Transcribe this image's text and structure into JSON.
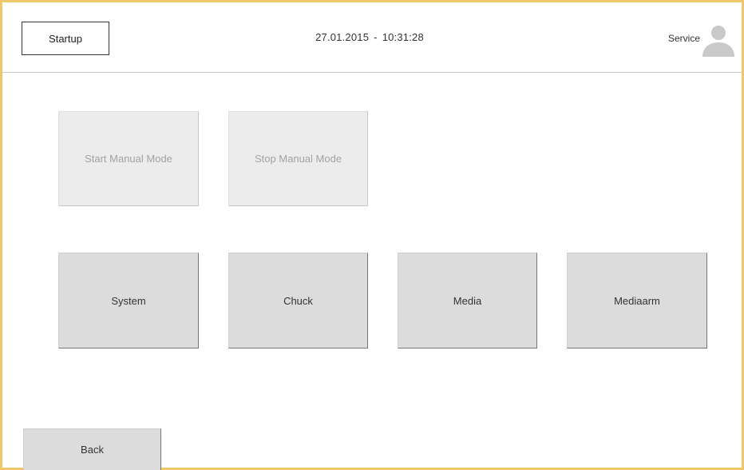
{
  "header": {
    "mode_button": "Startup",
    "date": "27.01.2015",
    "separator": "-",
    "time": "10:31:28",
    "user": "Service",
    "user_icon": "user-avatar-icon"
  },
  "manual_mode": {
    "start_label": "Start Manual Mode",
    "stop_label": "Stop Manual Mode"
  },
  "menu": {
    "system_label": "System",
    "chuck_label": "Chuck",
    "media_label": "Media",
    "mediaarm_label": "Mediaarm"
  },
  "footer": {
    "back_label": "Back"
  },
  "colors": {
    "frame_accent": "#f0c76b",
    "button_normal": "#dcdcdc",
    "button_disabled": "#ececec",
    "disabled_text": "#a3a3a3"
  }
}
